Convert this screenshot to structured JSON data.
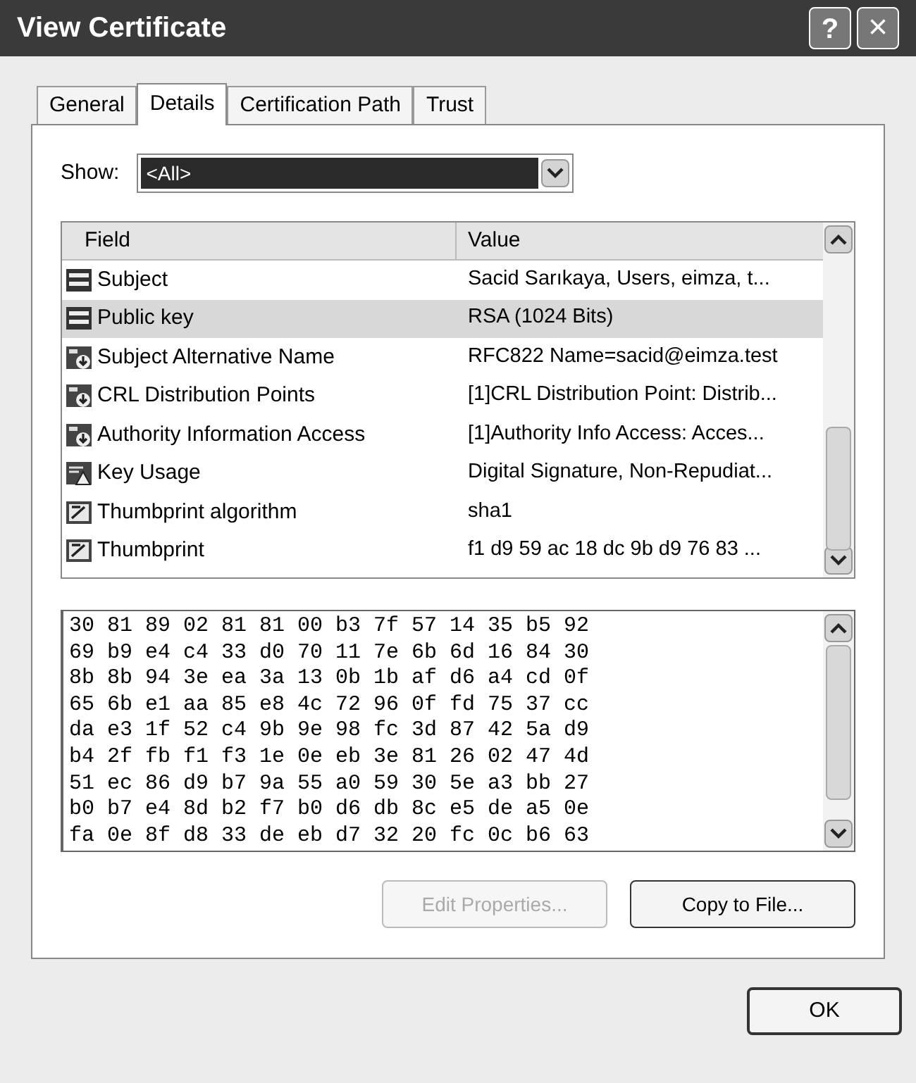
{
  "window": {
    "title": "View Certificate",
    "help_button": "?",
    "close_button": "×"
  },
  "tabs": [
    {
      "label": "General",
      "selected": false
    },
    {
      "label": "Details",
      "selected": true
    },
    {
      "label": "Certification Path",
      "selected": false
    },
    {
      "label": "Trust",
      "selected": false
    }
  ],
  "show": {
    "label": "Show:",
    "value": "<All>"
  },
  "table": {
    "columns": [
      "Field",
      "Value"
    ],
    "rows": [
      {
        "kind": "basic",
        "field": "Subject",
        "value": "Sacid Sarıkaya, Users, eimza, t...",
        "selected": false
      },
      {
        "kind": "basic",
        "field": "Public key",
        "value": "RSA (1024 Bits)",
        "selected": true
      },
      {
        "kind": "extension",
        "field": "Subject Alternative Name",
        "value": "RFC822 Name=sacid@eimza.test",
        "selected": false
      },
      {
        "kind": "extension",
        "field": "CRL Distribution Points",
        "value": "[1]CRL Distribution Point: Distrib...",
        "selected": false
      },
      {
        "kind": "extension",
        "field": "Authority Information Access",
        "value": "[1]Authority Info Access: Acces...",
        "selected": false
      },
      {
        "kind": "critical",
        "field": "Key Usage",
        "value": "Digital Signature, Non-Repudiat...",
        "selected": false
      },
      {
        "kind": "property",
        "field": "Thumbprint algorithm",
        "value": "sha1",
        "selected": false
      },
      {
        "kind": "property",
        "field": "Thumbprint",
        "value": "f1 d9 59 ac 18 dc 9b d9 76 83 ...",
        "selected": false
      }
    ]
  },
  "hex_lines": [
    "30 81 89 02 81 81 00 b3 7f 57 14 35 b5 92",
    "69 b9 e4 c4 33 d0 70 11 7e 6b 6d 16 84 30",
    "8b 8b 94 3e ea 3a 13 0b 1b af d6 a4 cd 0f",
    "65 6b e1 aa 85 e8 4c 72 96 0f fd 75 37 cc",
    "da e3 1f 52 c4 9b 9e 98 fc 3d 87 42 5a d9",
    "b4 2f fb f1 f3 1e 0e eb 3e 81 26 02 47 4d",
    "51 ec 86 d9 b7 9a 55 a0 59 30 5e a3 bb 27",
    "b0 b7 e4 8d b2 f7 b0 d6 db 8c e5 de a5 0e",
    "fa 0e 8f d8 33 de eb d7 32 20 fc 0c b6 63"
  ],
  "buttons": [
    {
      "label": "Edit Properties...",
      "disabled": true
    },
    {
      "label": "Copy to File...",
      "disabled": false
    }
  ],
  "ok_button": "OK"
}
